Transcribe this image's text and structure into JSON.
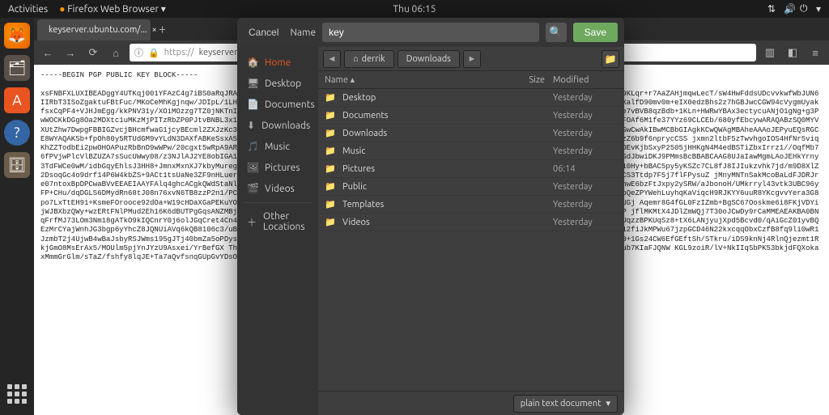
{
  "top_panel": {
    "activities": "Activities",
    "app_menu": "Firefox Web Browser",
    "clock": "Thu 06:15"
  },
  "firefox": {
    "tab_title": "keyserver.ubuntu.com/...",
    "url_prefix": "https://",
    "url": "keyserver.ubuntu.c",
    "pgp_header": "-----BEGIN PGP PUBLIC KEY BLOCK-----",
    "pgp_body": "xsFNBFXLUXIBEADggY4UTKqj001YFAzC4g7iBS0aRqJRA+nL9NKrHamdtNggfVywzf1DYJ4m96FVSp5j+9NudfkSZfMe+VmaCSAUdIdZG+zzG/fsf3Ri9hZ6S1tg6M3dyRZDh9KLqr+r7AaZAHjmqwLecT/sW4HwFddsUDcvvkwfWbJUN6IIRbT3ISoZgaktuFBtFuc/MKoCeMhKgjnqw/JDIpL/1LHyMyYWTZgrG41PqRSsi9/dKtW7XXd0EckmTjVRIZkvYCDMcObMZZL9MVbbu9S1TDUIHaFJA2IY+9RLp6A6a8ZLodiXalfD90mv0m+eIX0edzBhs2z7hGBJwcCGW94cVygmUyakfsxCqPF4+VJHJmEgg/kkPNV31y/XOiMOzzg7TZ0jNKTnIkqheK99K2CsVSRbGcnvSI1ekD+PkKjJinSx8u2mEr5xMLxIcfgM4RnVkujGetN5LlJmv72I3GCbhX2vLa0TLLBRTe7vBVB8qzBdb+1KLn+HWRwYBAx3ectycuANjO1gNg+g3PwWOCKkDGg8Oa2MDXtc1uMKzMjPITzRbZP0PJtvBNBL3x12BEGZwnDgpIYUAAC++yMvYVj5s4fYDDBCEg0ApNr+jwib5tSKuopBrBytrc63eZfli1uJ2bmi62BqGpkJMb/kIdMFOAf6M1fe37YYz69CLCEb/680yfEbcywARAQABzSQ0MYVXUtZhw7DwpgFBBIGZvcjBHcmfwaG1jcyBEcml2ZXJzKc3BeQTAQIAIzUCVcsRcFAh8JBwMCAQYVCAIJCgsEFgIDAQIeAQIXgAAKCRDOIcswOHJwOkEbEiJIaIECIFAlXLUXICGwCwAkIBwMCBbGIAgkKCwQWAgMBAheAAAoJEPyuEQsRGCE8WYAQAKSb+fpOh80y5RTUdGM9vYLdN3DAXfABKeSsxA5LdcZVLoW6pnviRdjBpTZTyZ4taLHA0pJcsk9u/Nb0yTAC/UY/qP6uXr7EilxeEKPrpI0tTePvz8igtzClvHydI1uzZ6b9f6nprycCSS jxmn2ltbF5zTwvhgoIOS4HfNr5viqKhZZTodbEi2pwOHOAPuzRbBnD9wWPw/20cgxt5wRpA9ARxWtBe1VFKhuT0kN2hJoL59NDPVueIsdbUOfGLfMdwnfAE3tKSd3LKNz1iVaRa46ucSDKANGZ/QciaD9Swjx4ToeKDEvKjbSxyP2505jHHKgN4M4edBSTiZbxIrrz1//OqfMb76fPVjwPlcVlBZUZA7sSucUWwy08/z3NJlAJ2YE8obIGA1dbHll8dJBVwiEczphEaVq2x0iDIzjI2SnELH5engzs8jK1BZ3EYaJe bJH3YD8alSKF4oZlaeb/dSF7jpVASZGCkSdJbwiDKJ9PMmsBcBBABCAAG8UJaIawMgmLAoJEHkYrny3TdFWCe0wM/idbGqyEhlsJ3HH8+JmnxMxnXJ7kbyMuregDhuIErEJARLuMbjxcffYH5vuLiRGGCJK1UYLMimVuuYdSEA2xkGgd6XKujKySJLqZnszDZbNWsxcDLqISyGdTa1l10Hy+bBAC5py5yKSZc7CL8fJ8IJIukzvhk7jd/m9D8XlZ2DsoqGc4o9drf14P6W4kbZS+9ACt1tsUaNe3ZF9nHLuerVfOdtZI1am8rhDTWvBzcUJQp10I6iz6NflShpQoAmD1G/RjgvF/1JW+EMLDpPuosA86gv+o7bxR20JmbID0J8LuwCS3Ttdp7F5j7flFPysuZ jMnyMNTnSakMcoBaLdFJDRJre07ntoxBpDPCwaBVvEEAEIAAYFAlq4ghcACgkQWdStaNlntpc22g/+JufN3IsZOFocZ7VbySo2heTLAXcEHS+eMN4u1nKzrcnyrkNKN7VVfMdH4mIQgJevhS8/eJTOCdTNwBPhwE6bzFtJxpy2ySRW/aJbonoH/UMkrryl43vtk3UBC96yFP+CHu/dqDGLS6DMydRn68tJ08n76xvN6TB8zzP2n1/PCGANvs9hlpTyxVLBuT7Ao6MibB7qyqcdNvLtSmnIpRGXj7psTNv/PGH2GJkMYThC1y1Mp4SA93vfbTqbgDxmgDXdDpQeZPYWehLuyhqKaViqcH9RJKYY6uuR8YKcgvvYera3G8po7LxTtEH91+KsmeFOrooce92dOa+W19cHDaXGaPEKuYOPVj+6/b7TLEtT6VajbX0d02qpVQYm9DZntrmej9Vi+tJzSs34bvc07TVnweJQL9LCwgzuJnoD/49EwzpsdeSUhVJUGj Aqemr8G4fGL0FzIZmb+BgSC67Ooskme6i8FKjVDYi jWJBXbzQWy+wzERtFNlPMud2Eh16K6dBUTPgGqsANZMBj/LuAtf8c/yBwMfeuMWoWMDHWj/vrcNUd9rcYs15hzK6Td68RNU/JNSjDFBRl280t6biS1TdibTBFbTwCQWUPsjGeP jflMKMtX4JDlZmWQj7T30oJCwDy9rCaMMEAEAKBA0BNqFrfMJ73LOm3Nm18gATkO9kIQCnrY0j6olJGqCret4Cn4LFwb9fcmuRAACqkQthaZF0j2SotnOD/49eUyzde5MChVG1NRSJ/cATS15moBKxLSocMmKMMcNNWe0ZubfB18TeabUqzzBPKUqSz8+tX6LANjyujXpd5Bcvd0/qAiGcZ01yvBQEzMrCYajWnhJG3bgp6yYhcZ8JQNUiAVq6kQB8106c3/uBeucGfFeEa4qi2fiJkMPWu67jzpGCD46N22kxcqgBrzQzZxxdqOPlsRJQ4uliAVq6kQB8Bl06c3/uBeucGfFeEa4q12fiJkMPWu67jzpGCD46N22kxcqqObxCzfB8fq9li0wR1JzmbT2j4UjwB4wBaJsbyRSJWms195gJTj40bmZa5oPDysxJP7XLUD6Em5MHueyOyZjo7yBhztd8REnNwGgDiLLXUE/1IE/65zbvyyifjDYDCMetxF83JkpJtyNnYJFhfDB8pD0+1Gs24CW6EfGEftSh/STkru/iDS9knNj4RlnQjezmt1RkjGmO8MsErAx5/MOUlm5pjYnJYzU9Asxei/YrBefGX ThHoFYM87OnpklNzo+YXZe9TKFnFq6LSO7YuMHLrqd5UZFMe /kzM 1ZjogbyyUDDJubismzDzONlr 7SonyF+KFWJub7KIaFJQNW KGL9zoiR/lV+NkIIqSbPK53bkjdFQXokaxMmmGrGlm/sTaZ/fshfy8lqJE+Ta7aQvfsnqGUpGvYDsOXnySqDppxwiUhwdsvpCX+MfiedfDtSo3c+Nilitu/fprR08nj4l3cdgc/pwGbK548R4erLZ"
  },
  "dialog": {
    "cancel": "Cancel",
    "name_label": "Name",
    "name_value": "key",
    "save": "Save",
    "sidebar": {
      "home": "Home",
      "desktop": "Desktop",
      "documents": "Documents",
      "downloads": "Downloads",
      "music": "Music",
      "pictures": "Pictures",
      "videos": "Videos",
      "other": "Other Locations"
    },
    "path": {
      "user": "derrik",
      "folder": "Downloads"
    },
    "columns": {
      "name": "Name",
      "size": "Size",
      "modified": "Modified"
    },
    "files": [
      {
        "name": "Desktop",
        "size": "",
        "modified": "Yesterday"
      },
      {
        "name": "Documents",
        "size": "",
        "modified": "Yesterday"
      },
      {
        "name": "Downloads",
        "size": "",
        "modified": "Yesterday"
      },
      {
        "name": "Music",
        "size": "",
        "modified": "Yesterday"
      },
      {
        "name": "Pictures",
        "size": "",
        "modified": "06:14"
      },
      {
        "name": "Public",
        "size": "",
        "modified": "Yesterday"
      },
      {
        "name": "Templates",
        "size": "",
        "modified": "Yesterday"
      },
      {
        "name": "Videos",
        "size": "",
        "modified": "Yesterday"
      }
    ],
    "filetype": "plain text document"
  }
}
